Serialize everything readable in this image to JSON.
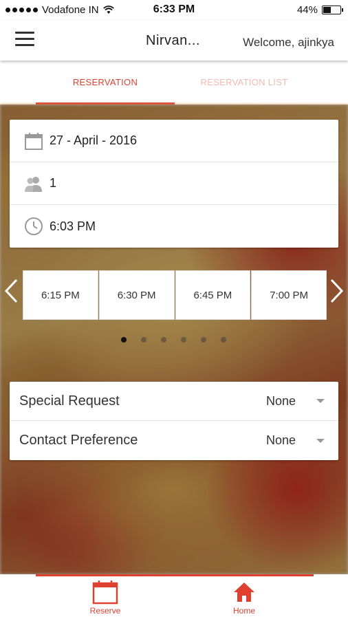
{
  "status_bar": {
    "carrier": "Vodafone IN",
    "time": "6:33 PM",
    "battery": "44%",
    "battery_level": 0.44
  },
  "app_bar": {
    "title": "Nirvan...",
    "welcome": "Welcome, ajinkya"
  },
  "tabs": [
    {
      "label": "RESERVATION",
      "active": true
    },
    {
      "label": "RESERVATION LIST",
      "active": false
    }
  ],
  "form": {
    "date": "27 - April - 2016",
    "guests": "1",
    "time": "6:03 PM"
  },
  "time_slots": [
    "6:15 PM",
    "6:30 PM",
    "6:45 PM",
    "7:00 PM"
  ],
  "pager": {
    "pages": 6,
    "active": 0
  },
  "preferences": [
    {
      "label": "Special Request",
      "value": "None"
    },
    {
      "label": "Contact Preference",
      "value": "None"
    }
  ],
  "bottom_nav": [
    {
      "label": "Reserve",
      "icon": "calendar-icon"
    },
    {
      "label": "Home",
      "icon": "home-icon"
    }
  ],
  "colors": {
    "accent": "#e04030",
    "tab_inactive": "#f4b9b0"
  }
}
